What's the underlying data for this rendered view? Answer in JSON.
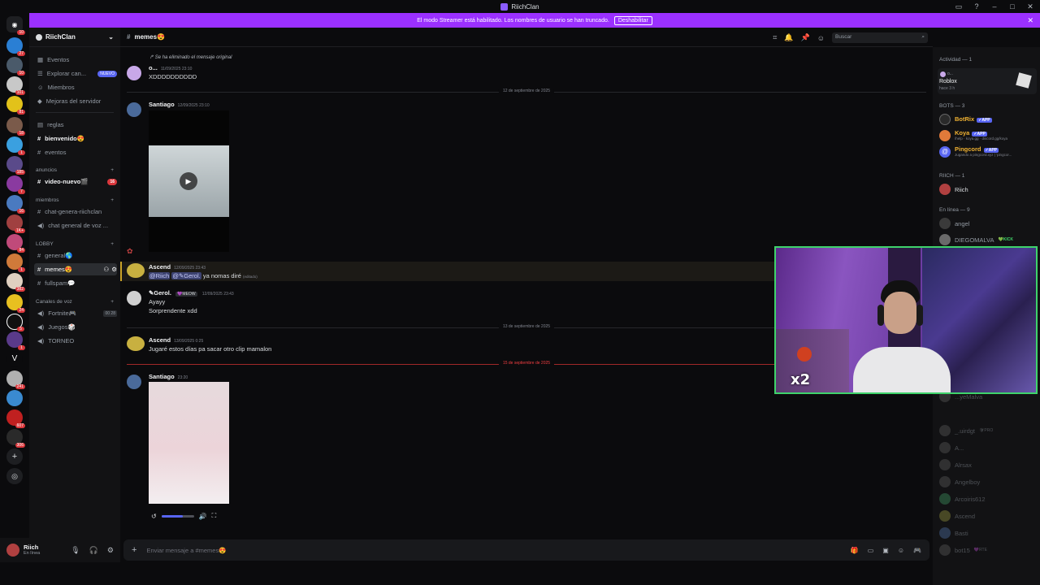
{
  "window": {
    "title": "RiichClan"
  },
  "banner": {
    "text": "El modo Streamer está habilitado. Los nombres de usuario se han truncado.",
    "button": "Deshabilitar"
  },
  "server_badges": [
    "10",
    "27",
    "10",
    "101",
    "81",
    "18",
    "1",
    "185",
    "7",
    "16",
    "1K+",
    "84",
    "1",
    "382",
    "24",
    "5",
    "1",
    "241",
    "607",
    "306"
  ],
  "sidebar": {
    "server_name": "RiichClan",
    "items": [
      {
        "label": "Eventos"
      },
      {
        "label": "Explorar can...",
        "badge": "NUEVO"
      },
      {
        "label": "Miembros"
      },
      {
        "label": "Mejoras del servidor"
      }
    ],
    "channels": [
      {
        "label": "reglas"
      },
      {
        "label": "bienvenido😍"
      },
      {
        "label": "eventos"
      }
    ],
    "cat_anuncios": "anuncios",
    "ch_video": "video-nuevo🎬",
    "ch_video_count": "16",
    "cat_miembros": "miembros",
    "ch_chat": "chat-genera-riichclan",
    "ch_voice": "chat general de voz ...",
    "cat_lobby": "LOBBY",
    "ch_general": "general🌎",
    "ch_memes": "memes😍",
    "ch_fullspam": "fullspam💬",
    "cat_voz": "Canales de voz",
    "ch_fortnite": "Fortnite🎮",
    "ch_fortnite_counts": "00 28",
    "ch_juegos": "Juegos🎲",
    "ch_torneo": "TORNEO"
  },
  "user": {
    "name": "Riich",
    "status": "En línea"
  },
  "channel": {
    "name": "memes😍",
    "search_placeholder": "Buscar"
  },
  "messages": {
    "reply_note": "Se ha eliminado el mensaje original",
    "m0_user": "o...",
    "m0_time": "11/09/2025 23:10",
    "m0_text": "XDDDDDDDDDD",
    "d1": "12 de septiembre de 2025",
    "m1_user": "Santiago",
    "m1_time": "12/09/2025 23:10",
    "m2_user": "Ascend",
    "m2_time": "12/09/2025 23:43",
    "m2_mention1": "@Riich",
    "m2_mention2": "@✎Gerol.",
    "m2_text": "ya nomas diré",
    "m2_edited": "(editado)",
    "m3_user": "✎Gerol.",
    "m3_tag": "💜MEOW",
    "m3_time": "12/09/2025 23:43",
    "m3_text1": "Ayayy",
    "m3_text2": "Sorprendente xdd",
    "d2": "13 de septiembre de 2025",
    "m4_user": "Ascend",
    "m4_time": "13/09/2025 0:25",
    "m4_text": "Jugaré estos días pa sacar otro clip mamalon",
    "d3": "15 de septiembre de 2025",
    "m5_user": "Santiago",
    "m5_time": "23:20",
    "video_volume": 0.65
  },
  "composer": {
    "placeholder": "Enviar mensaje a #memes😍"
  },
  "members": {
    "activity_header": "Actividad — 1",
    "activity_user": "o...",
    "activity_game": "Roblox",
    "activity_time": "hace 3 h",
    "bots_header": "BOTS — 3",
    "bot1": "BotRix",
    "bot2": "Koya",
    "bot2_status": "/help · koya.gg · discord.gg/koya",
    "bot3": "Pingcord",
    "bot3_status": "Jugando a pingcord.xyz | 'pingcor...",
    "app_tag": "✓APP",
    "riich_header": "RIICH — 1",
    "riich": "Riich",
    "online_header": "En línea — 9",
    "on1": "angel",
    "on2": "DIEGOMALVA",
    "on2_tag": "💚KICK",
    "offline": [
      "...yeMalva",
      "_.uirdgt",
      "A...",
      "Alrsax",
      "Angelboy",
      "Arcoiris612",
      "Ascend",
      "Basti",
      "bot15"
    ],
    "offline_tag1": "🛡PRO",
    "offline_tag2": "💜RTE"
  },
  "overlay": {
    "text": "x2"
  }
}
